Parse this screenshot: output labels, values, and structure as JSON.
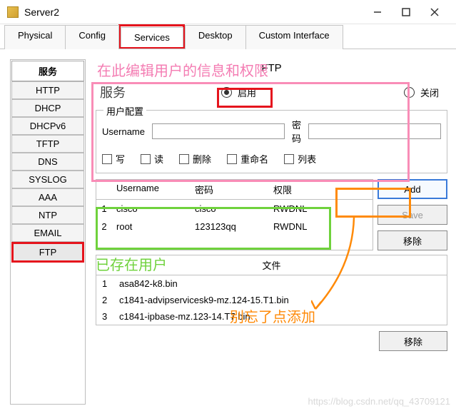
{
  "window": {
    "title": "Server2"
  },
  "tabs": [
    "Physical",
    "Config",
    "Services",
    "Desktop",
    "Custom Interface"
  ],
  "active_tab": "Services",
  "sidebar": {
    "header": "服务",
    "items": [
      "HTTP",
      "DHCP",
      "DHCPv6",
      "TFTP",
      "DNS",
      "SYSLOG",
      "AAA",
      "NTP",
      "EMAIL",
      "FTP"
    ],
    "active": "FTP"
  },
  "panel": {
    "title": "FTP",
    "service_label": "服务",
    "radio_on": "启用",
    "radio_off": "关闭",
    "radio_value": "on"
  },
  "userconf": {
    "legend": "用户配置",
    "username_label": "Username",
    "password_label": "密码",
    "perms": {
      "write": "写",
      "read": "读",
      "delete": "删除",
      "rename": "重命名",
      "list": "列表"
    }
  },
  "usertable": {
    "headers": {
      "username": "Username",
      "password": "密码",
      "perm": "权限"
    },
    "rows": [
      {
        "idx": "1",
        "username": "cisco",
        "password": "cisco",
        "perm": "RWDNL"
      },
      {
        "idx": "2",
        "username": "root",
        "password": "123123qq",
        "perm": "RWDNL"
      }
    ]
  },
  "buttons": {
    "add": "Add",
    "save": "Save",
    "remove": "移除",
    "remove2": "移除"
  },
  "files": {
    "header": "文件",
    "rows": [
      {
        "idx": "1",
        "name": "asa842-k8.bin"
      },
      {
        "idx": "2",
        "name": "c1841-advipservicesk9-mz.124-15.T1.bin"
      },
      {
        "idx": "3",
        "name": "c1841-ipbase-mz.123-14.T7.bin"
      }
    ]
  },
  "annotations": {
    "pink": "在此编辑用户的信息和权限",
    "green": "已存在用户",
    "orange": "别忘了点添加"
  },
  "watermark": "https://blog.csdn.net/qq_43709121"
}
